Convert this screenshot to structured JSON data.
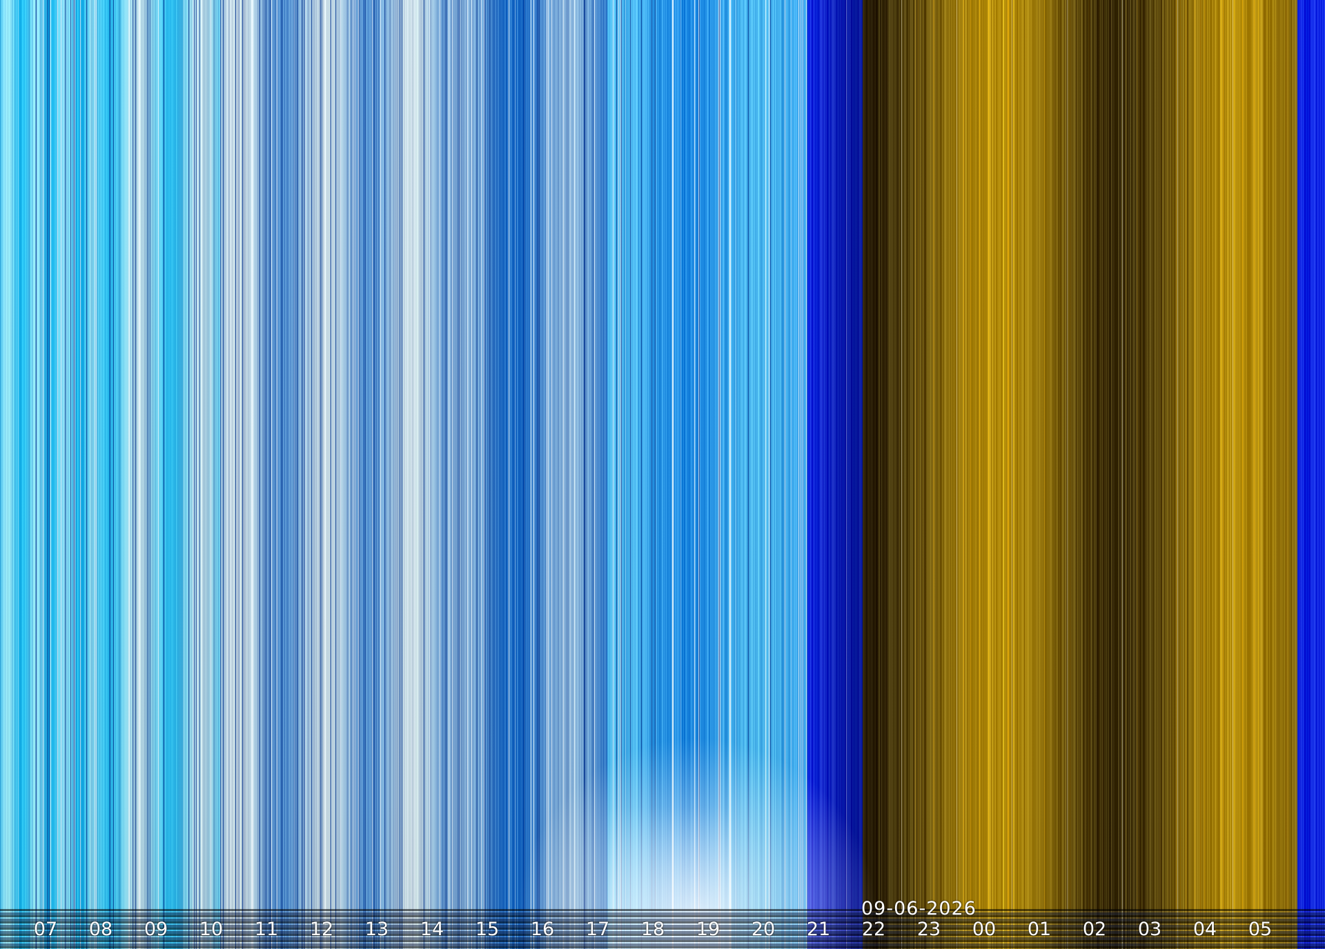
{
  "image": {
    "kind": "keogram-timelapse",
    "date": "09-06-2026",
    "hour_labels": [
      "07",
      "08",
      "09",
      "10",
      "11",
      "12",
      "13",
      "14",
      "15",
      "16",
      "17",
      "18",
      "19",
      "20",
      "21",
      "22",
      "23",
      "00",
      "01",
      "02",
      "03",
      "04",
      "05"
    ],
    "colors": {
      "day_cyan": "#18b8f0",
      "day_pale": "#c8dce6",
      "day_blue": "#1a6cc8",
      "dusk_blue": "#0a24e6",
      "night_gold": "#b8900c",
      "night_dark": "#2a200a"
    }
  }
}
